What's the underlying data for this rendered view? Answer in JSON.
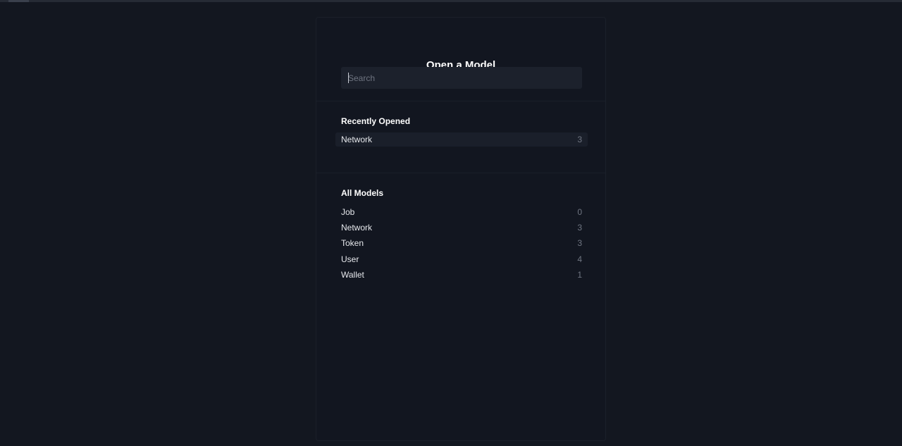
{
  "dialog": {
    "title": "Open a Model",
    "search_placeholder": "Search"
  },
  "recent": {
    "heading": "Recently Opened",
    "items": [
      {
        "label": "Network",
        "count": "3"
      }
    ]
  },
  "all_models": {
    "heading": "All Models",
    "items": [
      {
        "label": "Job",
        "count": "0"
      },
      {
        "label": "Network",
        "count": "3"
      },
      {
        "label": "Token",
        "count": "3"
      },
      {
        "label": "User",
        "count": "4"
      },
      {
        "label": "Wallet",
        "count": "1"
      }
    ]
  }
}
